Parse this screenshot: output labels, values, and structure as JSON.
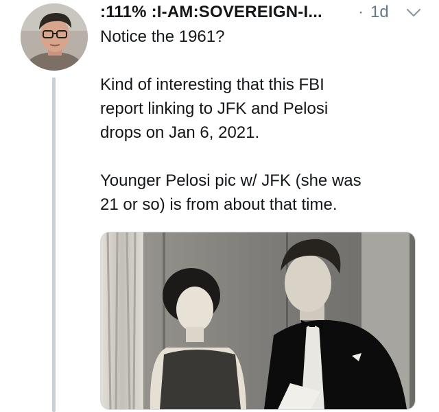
{
  "tweet": {
    "display_name": ":111% :I-AM:SOVEREIGN-I...",
    "separator": "·",
    "timestamp": "1d",
    "avatar_icon": "profile-photo",
    "menu_icon": "chevron-down-icon",
    "paragraphs": [
      {
        "lines": [
          "Notice the 1961?"
        ]
      },
      {
        "lines": [
          "Kind of interesting that this FBI",
          "report linking to JFK and Pelosi",
          "drops on Jan 6, 2021."
        ]
      },
      {
        "lines": [
          "Younger Pelosi pic w/ JFK  (she was",
          "21 or so) is from about that time."
        ]
      }
    ],
    "media": {
      "kind": "black-and-white photograph",
      "colors": {
        "background": "#8a8a86",
        "suit": "#0c0c0c",
        "curtain": "#d6d3cb"
      }
    }
  },
  "colors": {
    "text": "#14171a",
    "meta": "#657786",
    "thread_line": "#c9d1d8",
    "background": "#ffffff"
  }
}
